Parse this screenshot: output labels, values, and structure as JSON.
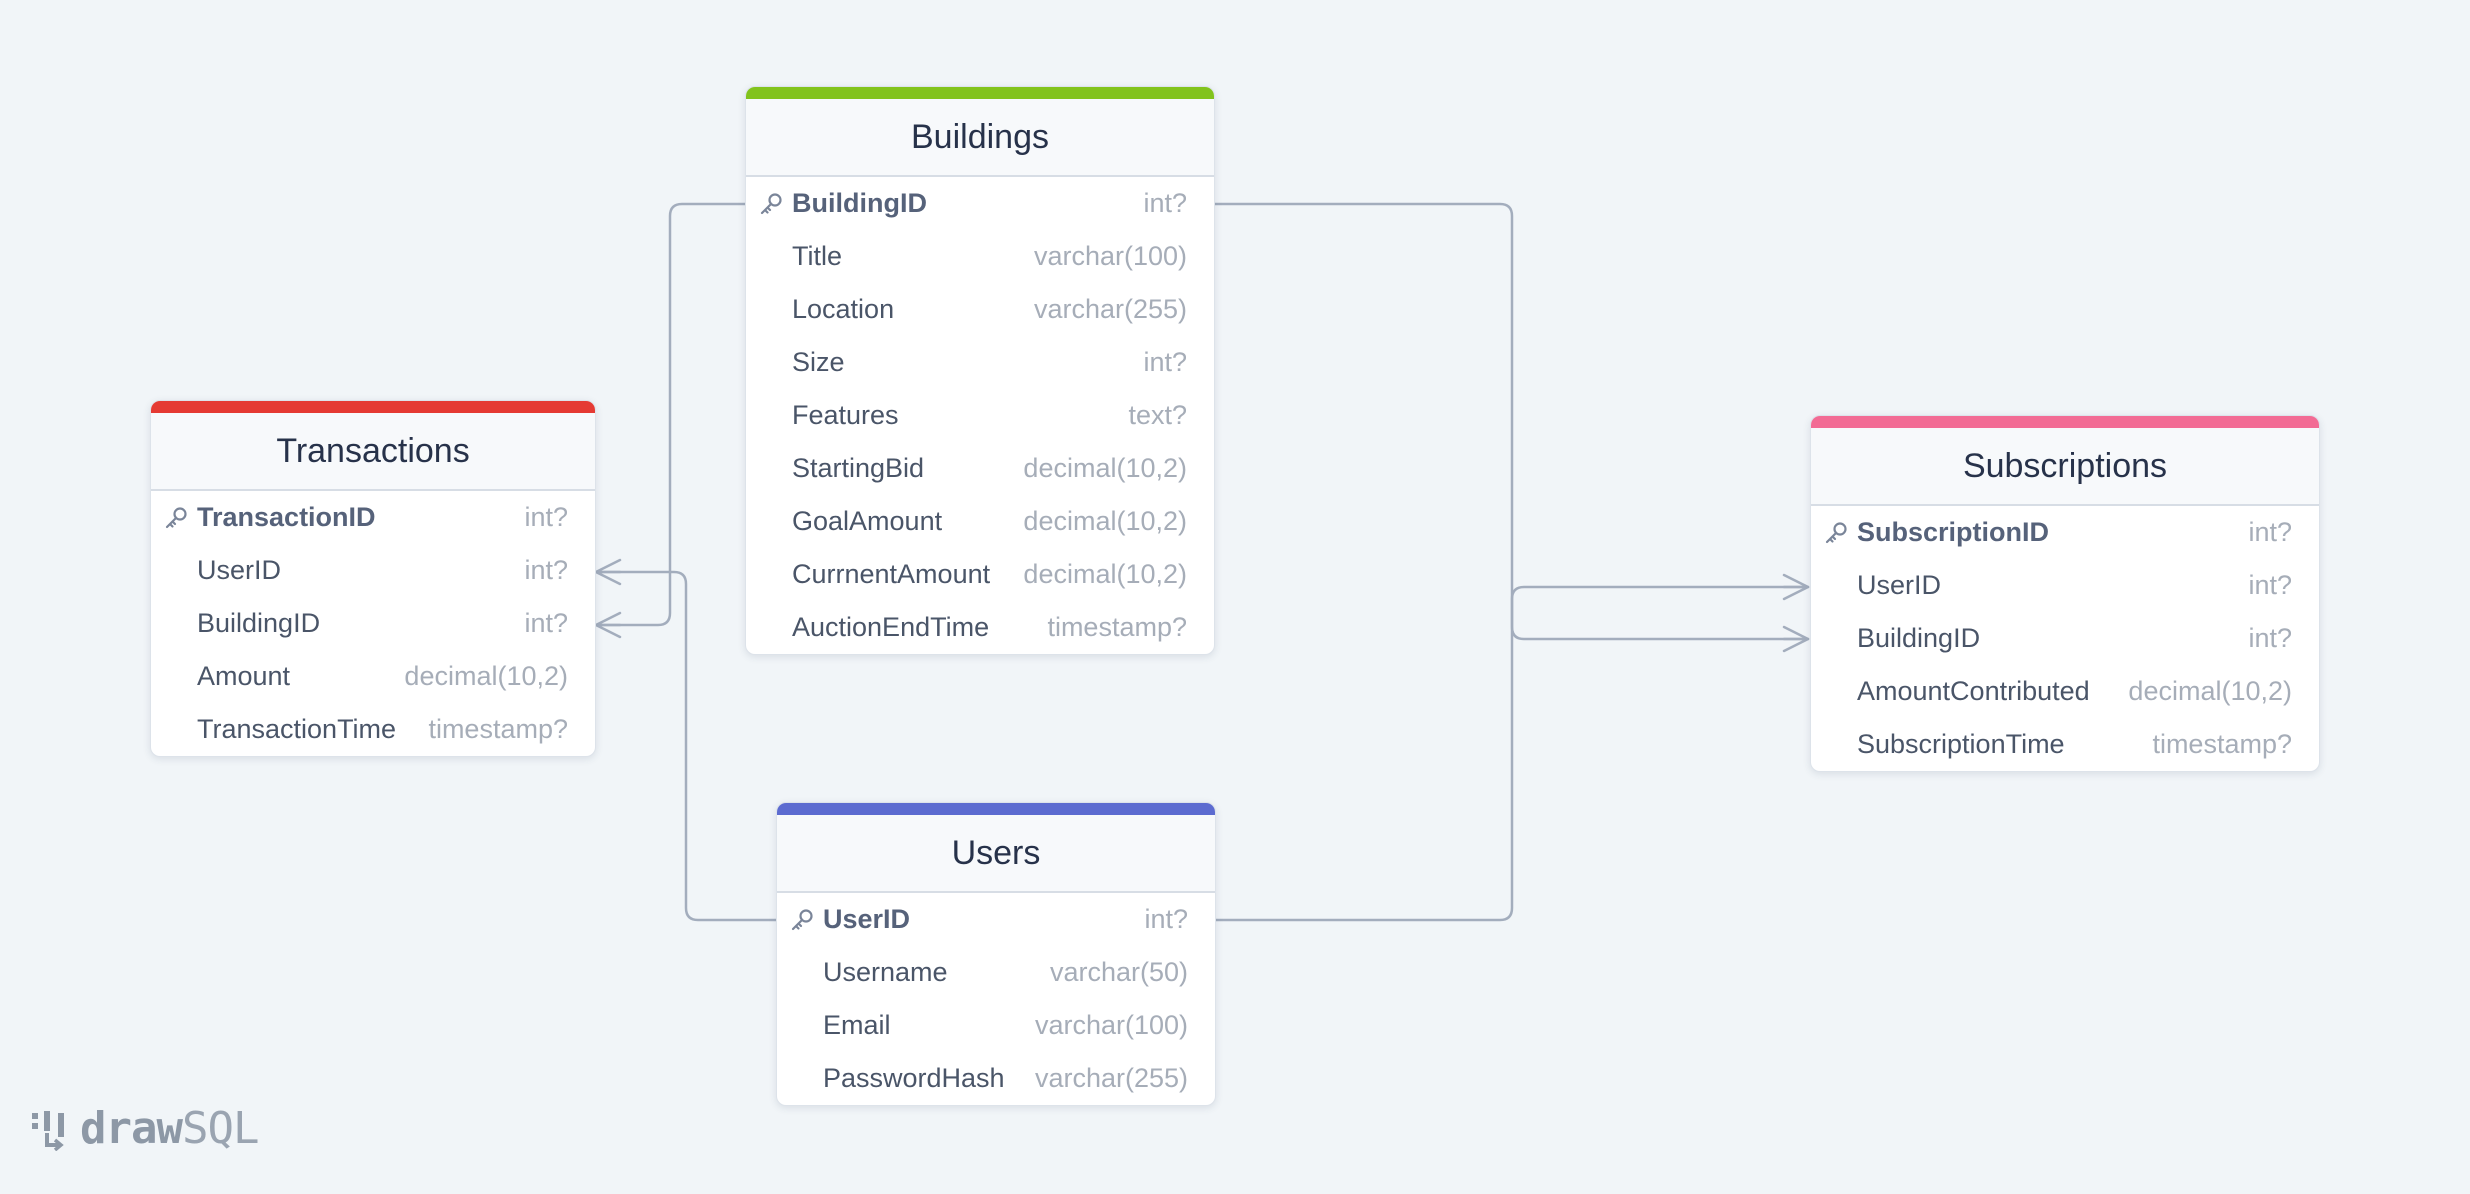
{
  "colors": {
    "background": "#f1f5f8",
    "link": "#a3adbd",
    "transactions_accent": "#e53a33",
    "buildings_accent": "#82c31c",
    "users_accent": "#5c6bd0",
    "subscriptions_accent": "#f26b94"
  },
  "tables": {
    "transactions": {
      "name": "Transactions",
      "columns": [
        {
          "name": "TransactionID",
          "type": "int?",
          "pk": true
        },
        {
          "name": "UserID",
          "type": "int?"
        },
        {
          "name": "BuildingID",
          "type": "int?"
        },
        {
          "name": "Amount",
          "type": "decimal(10,2)"
        },
        {
          "name": "TransactionTime",
          "type": "timestamp?"
        }
      ]
    },
    "buildings": {
      "name": "Buildings",
      "columns": [
        {
          "name": "BuildingID",
          "type": "int?",
          "pk": true
        },
        {
          "name": "Title",
          "type": "varchar(100)"
        },
        {
          "name": "Location",
          "type": "varchar(255)"
        },
        {
          "name": "Size",
          "type": "int?"
        },
        {
          "name": "Features",
          "type": "text?"
        },
        {
          "name": "StartingBid",
          "type": "decimal(10,2)"
        },
        {
          "name": "GoalAmount",
          "type": "decimal(10,2)"
        },
        {
          "name": "CurrnentAmount",
          "type": "decimal(10,2)"
        },
        {
          "name": "AuctionEndTime",
          "type": "timestamp?"
        }
      ]
    },
    "users": {
      "name": "Users",
      "columns": [
        {
          "name": "UserID",
          "type": "int?",
          "pk": true
        },
        {
          "name": "Username",
          "type": "varchar(50)"
        },
        {
          "name": "Email",
          "type": "varchar(100)"
        },
        {
          "name": "PasswordHash",
          "type": "varchar(255)"
        }
      ]
    },
    "subscriptions": {
      "name": "Subscriptions",
      "columns": [
        {
          "name": "SubscriptionID",
          "type": "int?",
          "pk": true
        },
        {
          "name": "UserID",
          "type": "int?"
        },
        {
          "name": "BuildingID",
          "type": "int?"
        },
        {
          "name": "AmountContributed",
          "type": "decimal(10,2)"
        },
        {
          "name": "SubscriptionTime",
          "type": "timestamp?"
        }
      ]
    }
  },
  "relationships": [
    {
      "from": "buildings.BuildingID",
      "to": "transactions.BuildingID",
      "cardinality": "one-to-many"
    },
    {
      "from": "users.UserID",
      "to": "transactions.UserID",
      "cardinality": "one-to-many"
    },
    {
      "from": "buildings.BuildingID",
      "to": "subscriptions.BuildingID",
      "cardinality": "one-to-many"
    },
    {
      "from": "users.UserID",
      "to": "subscriptions.UserID",
      "cardinality": "one-to-many"
    }
  ],
  "logo": {
    "bold": "draw",
    "light": "SQL"
  },
  "icons": {
    "primary_key": "key-icon",
    "logo_mark": "drawsql-logo-icon"
  }
}
